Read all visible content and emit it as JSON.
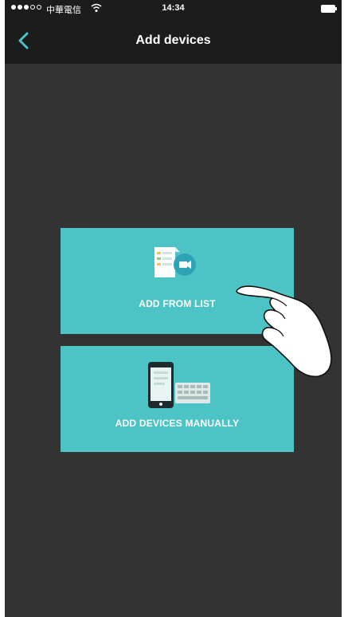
{
  "status_bar": {
    "carrier": "中華電信",
    "time": "14:34"
  },
  "nav": {
    "title": "Add devices",
    "back_icon": "chevron-left-icon"
  },
  "options": {
    "add_from_list": {
      "label": "ADD FROM LIST",
      "icon": "device-list-icon"
    },
    "add_manually": {
      "label": "ADD DEVICES MANUALLY",
      "icon": "phone-keyboard-icon"
    }
  },
  "colors": {
    "accent": "#4cc3c4",
    "background": "#333333",
    "bar": "#1c1c1c",
    "back_arrow": "#4cc3c4"
  }
}
